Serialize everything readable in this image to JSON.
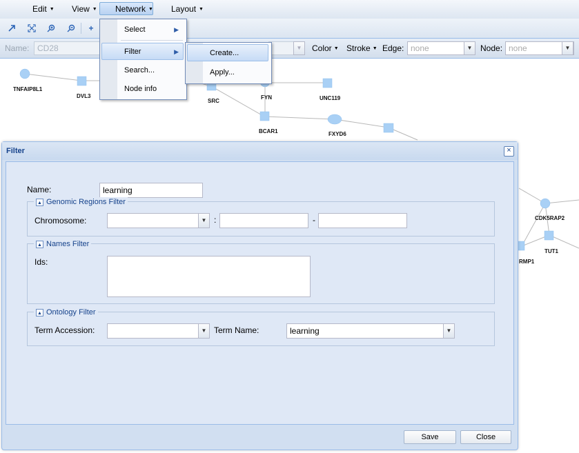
{
  "menubar": {
    "items": [
      {
        "label": "Edit"
      },
      {
        "label": "View"
      },
      {
        "label": "Network"
      },
      {
        "label": "Layout"
      }
    ]
  },
  "propbar": {
    "name_label": "Name:",
    "name_value": "CD28",
    "color_label": "Color",
    "stroke_label": "Stroke",
    "edge_label": "Edge:",
    "edge_value": "none",
    "node_label": "Node:",
    "node_value": "none"
  },
  "network_menu": {
    "items": [
      {
        "label": "Select"
      },
      {
        "label": "Filter"
      },
      {
        "label": "Search..."
      },
      {
        "label": "Node info"
      }
    ]
  },
  "filter_submenu": {
    "items": [
      {
        "label": "Create..."
      },
      {
        "label": "Apply..."
      }
    ]
  },
  "graph": {
    "nodes": [
      "TNFAIP8L1",
      "DVL3",
      "SRC",
      "FYN",
      "UNC119",
      "BCAR1",
      "FXYD6",
      "CDK5RAP2",
      "TUT1",
      "RMP1"
    ]
  },
  "filter_window": {
    "title": "Filter",
    "name_label": "Name:",
    "name_value": "learning",
    "genomic": {
      "legend": "Genomic Regions Filter",
      "chromosome_label": "Chromosome:",
      "colon": ":",
      "dash": "-"
    },
    "names": {
      "legend": "Names Filter",
      "ids_label": "Ids:"
    },
    "ontology": {
      "legend": "Ontology Filter",
      "term_accession_label": "Term Accession:",
      "term_name_label": "Term Name:",
      "term_name_value": "learning"
    },
    "save_label": "Save",
    "close_label": "Close"
  },
  "colors": {
    "node_fill": "#a9d0f5",
    "accent": "#15428b",
    "menu_highlight": "#c6dbf6"
  }
}
